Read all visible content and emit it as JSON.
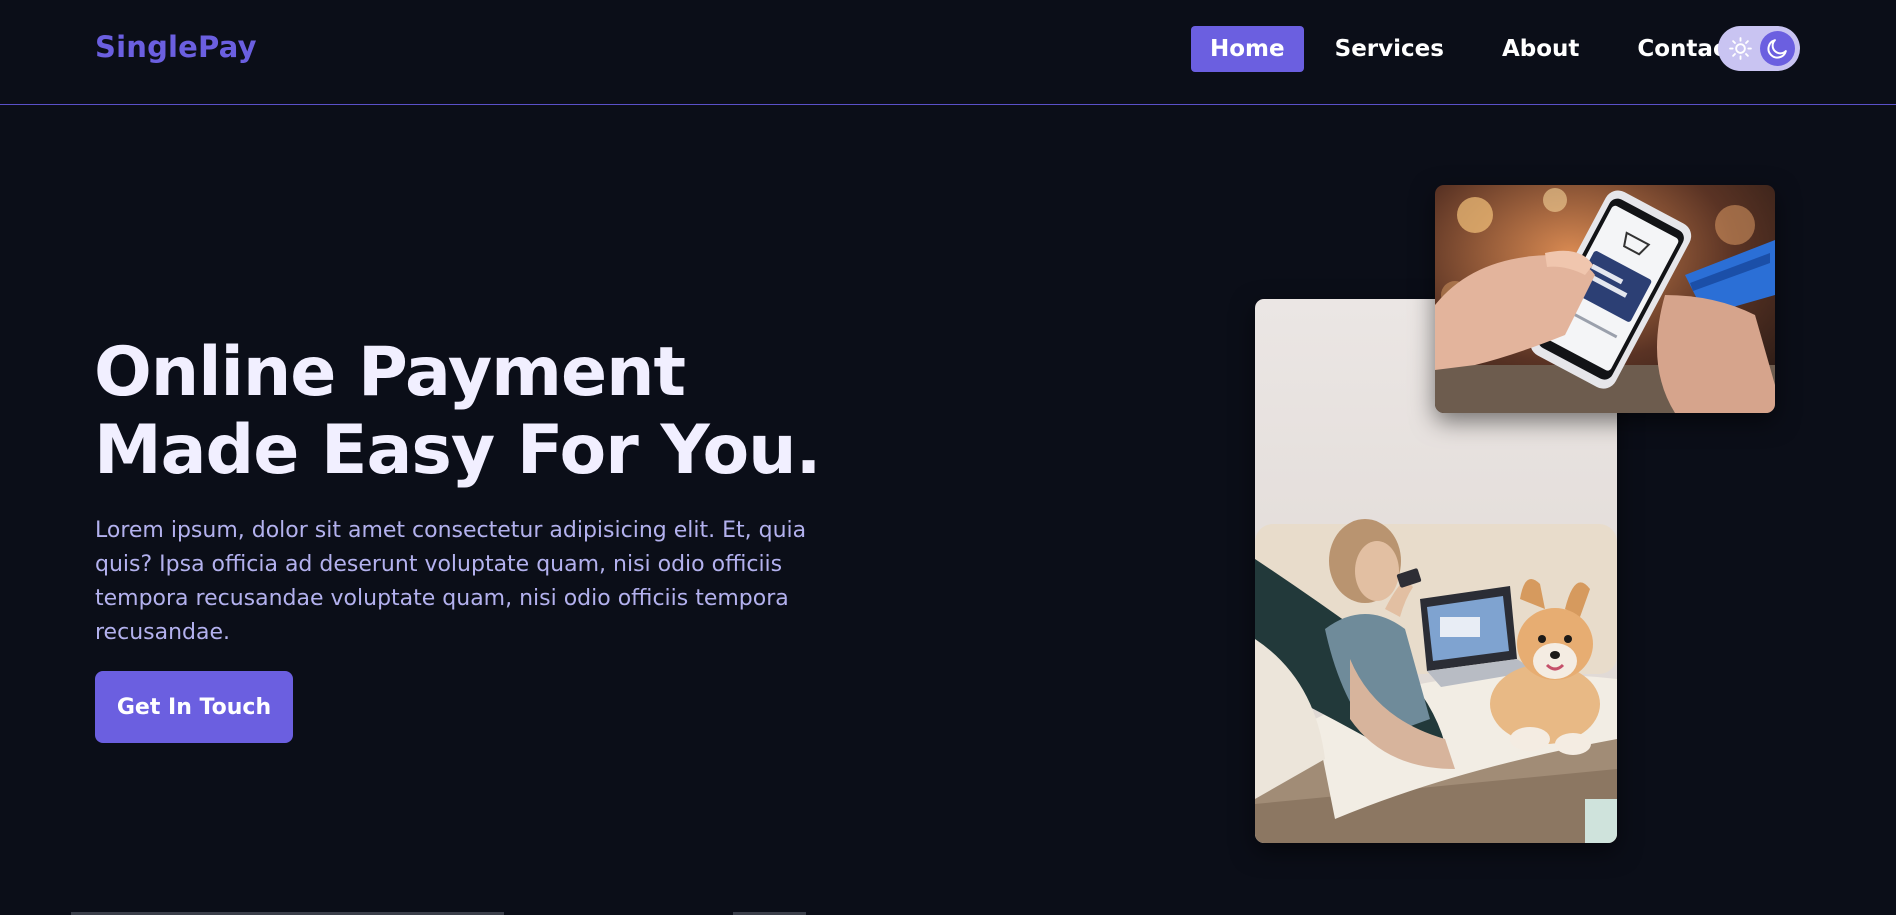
{
  "header": {
    "logo": "SinglePay",
    "nav": [
      {
        "label": "Home",
        "active": true
      },
      {
        "label": "Services",
        "active": false
      },
      {
        "label": "About",
        "active": false
      },
      {
        "label": "Contact",
        "active": false
      }
    ],
    "theme_toggle": {
      "left_icon": "sun-icon",
      "right_icon": "moon-icon",
      "mode": "dark"
    }
  },
  "hero": {
    "title": "Online Payment Made Easy For You.",
    "description": "Lorem ipsum, dolor sit amet consectetur adipisicing elit. Et, quia quis? Ipsa officia ad deserunt voluptate quam, nisi odio officiis tempora recusandae voluptate quam, nisi odio officiis tempora recusandae.",
    "cta_label": "Get In Touch"
  },
  "colors": {
    "background": "#0b0e18",
    "accent": "#6b5fe0",
    "title": "#f1efff",
    "body_text": "#b3b1ee"
  }
}
